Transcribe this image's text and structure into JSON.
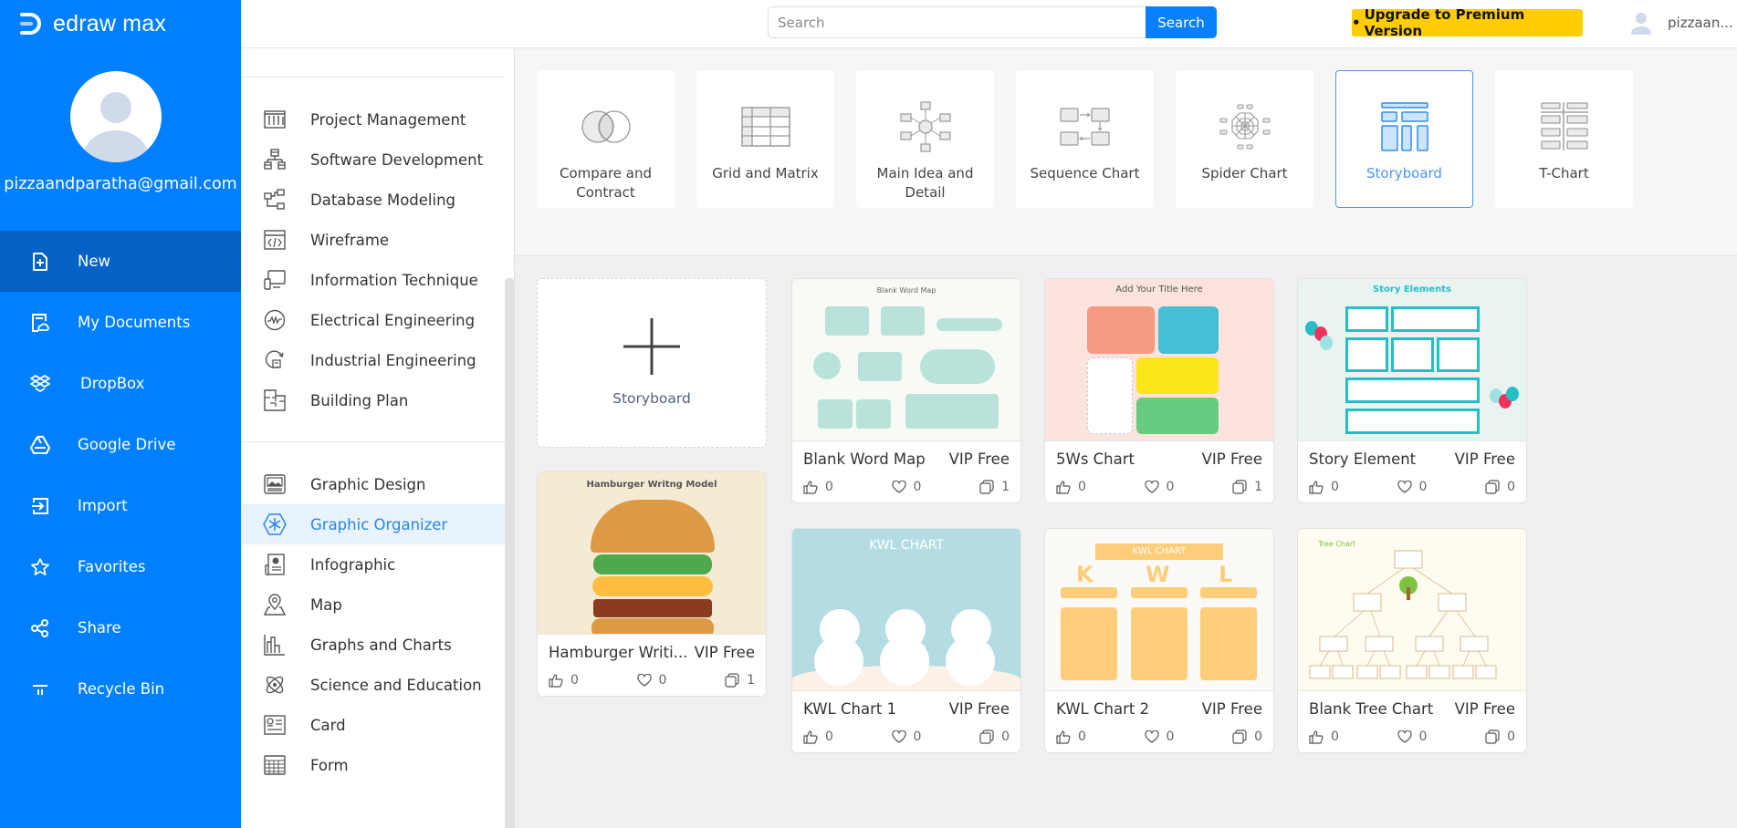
{
  "app": {
    "logo_text": "edraw max"
  },
  "user": {
    "email": "pizzaandparatha@gmail.com",
    "short_name": "pizzaan..."
  },
  "leftnav": {
    "items": [
      {
        "label": "New",
        "icon": "new-file-icon",
        "active": true
      },
      {
        "label": "My Documents",
        "icon": "my-documents-icon"
      },
      {
        "label": "DropBox",
        "icon": "dropbox-icon"
      },
      {
        "label": "Google Drive",
        "icon": "google-drive-icon"
      },
      {
        "label": "Import",
        "icon": "import-icon"
      },
      {
        "label": "Favorites",
        "icon": "star-icon"
      },
      {
        "label": "Share",
        "icon": "share-icon"
      },
      {
        "label": "Recycle Bin",
        "icon": "recycle-bin-icon"
      }
    ]
  },
  "topbar": {
    "search_placeholder": "Search",
    "search_value": "",
    "search_button": "Search",
    "upgrade_label": "Upgrade to Premium Version"
  },
  "categories": {
    "group1": [
      {
        "label": "Project Management",
        "icon": "project-management-icon"
      },
      {
        "label": "Software Development",
        "icon": "software-development-icon"
      },
      {
        "label": "Database Modeling",
        "icon": "database-modeling-icon"
      },
      {
        "label": "Wireframe",
        "icon": "wireframe-icon"
      },
      {
        "label": "Information Technique",
        "icon": "information-technique-icon"
      },
      {
        "label": "Electrical Engineering",
        "icon": "electrical-engineering-icon"
      },
      {
        "label": "Industrial Engineering",
        "icon": "industrial-engineering-icon"
      },
      {
        "label": "Building Plan",
        "icon": "building-plan-icon"
      }
    ],
    "group2": [
      {
        "label": "Graphic Design",
        "icon": "graphic-design-icon"
      },
      {
        "label": "Graphic Organizer",
        "icon": "graphic-organizer-icon",
        "active": true
      },
      {
        "label": "Infographic",
        "icon": "infographic-icon"
      },
      {
        "label": "Map",
        "icon": "map-pin-icon"
      },
      {
        "label": "Graphs and Charts",
        "icon": "bar-chart-icon"
      },
      {
        "label": "Science and Education",
        "icon": "atom-icon"
      },
      {
        "label": "Card",
        "icon": "card-icon"
      },
      {
        "label": "Form",
        "icon": "form-icon"
      }
    ]
  },
  "subtypes": [
    {
      "label": "Compare and Contract",
      "icon": "venn-icon"
    },
    {
      "label": "Grid and Matrix",
      "icon": "grid-icon"
    },
    {
      "label": "Main Idea and Detail",
      "icon": "main-idea-icon"
    },
    {
      "label": "Sequence Chart",
      "icon": "sequence-icon"
    },
    {
      "label": "Spider Chart",
      "icon": "spider-icon"
    },
    {
      "label": "Storyboard",
      "icon": "storyboard-icon",
      "active": true
    },
    {
      "label": "T-Chart",
      "icon": "t-chart-icon"
    }
  ],
  "new_card": {
    "label": "Storyboard"
  },
  "templates": [
    {
      "name": "Hamburger Writi...",
      "badge": "VIP Free",
      "likes": "0",
      "favorites": "0",
      "copies": "1",
      "thumb_title": "Hamburger Writng Model"
    },
    {
      "name": "Blank Word Map",
      "badge": "VIP Free",
      "likes": "0",
      "favorites": "0",
      "copies": "1",
      "thumb_title": "Blank Word Map"
    },
    {
      "name": "5Ws Chart",
      "badge": "VIP Free",
      "likes": "0",
      "favorites": "0",
      "copies": "1",
      "thumb_title": "Add Your Title Here"
    },
    {
      "name": "Story Element",
      "badge": "VIP Free",
      "likes": "0",
      "favorites": "0",
      "copies": "0",
      "thumb_title": "Story Elements"
    },
    {
      "name": "KWL Chart 1",
      "badge": "VIP Free",
      "likes": "0",
      "favorites": "0",
      "copies": "0",
      "thumb_title": "KWL CHART"
    },
    {
      "name": "KWL Chart 2",
      "badge": "VIP Free",
      "likes": "0",
      "favorites": "0",
      "copies": "0",
      "thumb_title": "KWL CHART"
    },
    {
      "name": "Blank Tree Chart",
      "badge": "VIP Free",
      "likes": "0",
      "favorites": "0",
      "copies": "0",
      "thumb_title": "Tree Chart"
    }
  ],
  "colors": {
    "brand": "#0080fe",
    "nav_active": "#0461c5",
    "accent": "#4e95ef",
    "upgrade": "#ffcd00"
  }
}
